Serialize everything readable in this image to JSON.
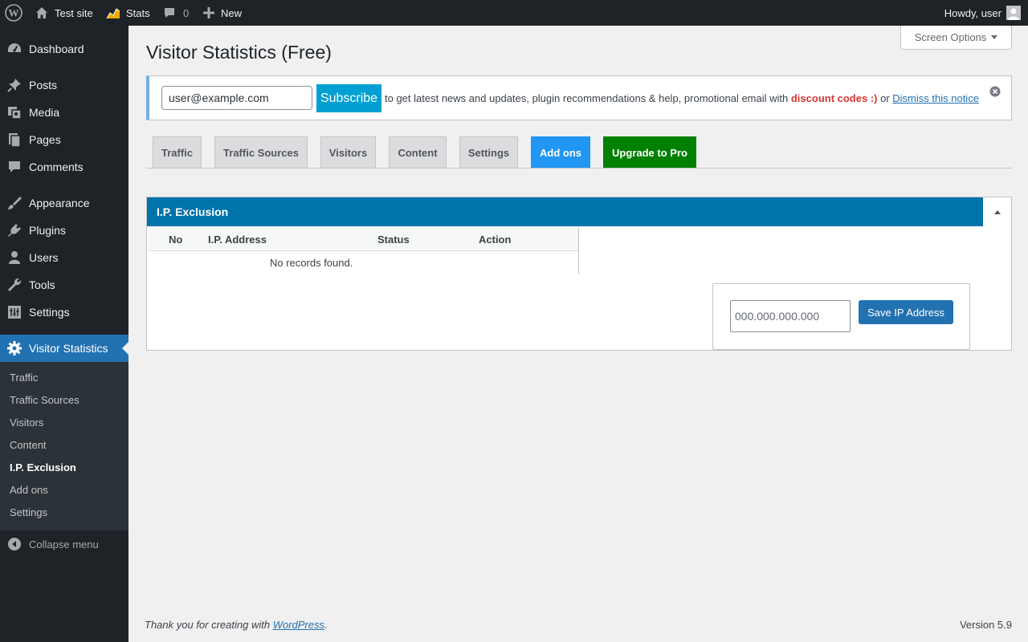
{
  "adminbar": {
    "site_name": "Test site",
    "stats_label": "Stats",
    "comments_count": "0",
    "new_label": "New",
    "howdy": "Howdy, user"
  },
  "sidebar": {
    "items": [
      {
        "label": "Dashboard",
        "icon": "dashboard-icon"
      },
      {
        "label": "Posts",
        "icon": "pushpin-icon"
      },
      {
        "label": "Media",
        "icon": "media-icon"
      },
      {
        "label": "Pages",
        "icon": "pages-icon"
      },
      {
        "label": "Comments",
        "icon": "comment-icon"
      },
      {
        "label": "Appearance",
        "icon": "brush-icon"
      },
      {
        "label": "Plugins",
        "icon": "plug-icon"
      },
      {
        "label": "Users",
        "icon": "user-icon"
      },
      {
        "label": "Tools",
        "icon": "wrench-icon"
      },
      {
        "label": "Settings",
        "icon": "settings-sliders-icon"
      },
      {
        "label": "Visitor Statistics",
        "icon": "gear-icon"
      }
    ],
    "submenu": [
      "Traffic",
      "Traffic Sources",
      "Visitors",
      "Content",
      "I.P. Exclusion",
      "Add ons",
      "Settings"
    ],
    "collapse": "Collapse menu"
  },
  "screen_options": "Screen Options",
  "page_title": "Visitor Statistics (Free)",
  "notice": {
    "email_value": "user@example.com",
    "subscribe": "Subscribe",
    "text_before": "to get latest news and updates, plugin recommendations & help, promotional email with ",
    "discount": "discount codes :)",
    "text_or": " or ",
    "dismiss_link": "Dismiss this notice"
  },
  "tabs": [
    "Traffic",
    "Traffic Sources",
    "Visitors",
    "Content",
    "Settings",
    "Add ons",
    "Upgrade to Pro"
  ],
  "panel": {
    "title": "I.P. Exclusion",
    "columns": [
      "No",
      "I.P. Address",
      "Status",
      "Action"
    ],
    "empty": "No records found.",
    "ip_placeholder": "000.000.000.000",
    "save_label": "Save IP Address"
  },
  "footer": {
    "thanks_before": "Thank you for creating with ",
    "wp_link": "WordPress",
    "thanks_after": ".",
    "version": "Version 5.9"
  },
  "colors": {
    "admin_dark": "#1d2327",
    "primary_blue": "#2271b1",
    "panel_header": "#0073aa",
    "subscribe": "#00a0d2",
    "addons_tab": "#2196f3",
    "upgrade_tab": "#008000",
    "discount": "#d63638"
  }
}
